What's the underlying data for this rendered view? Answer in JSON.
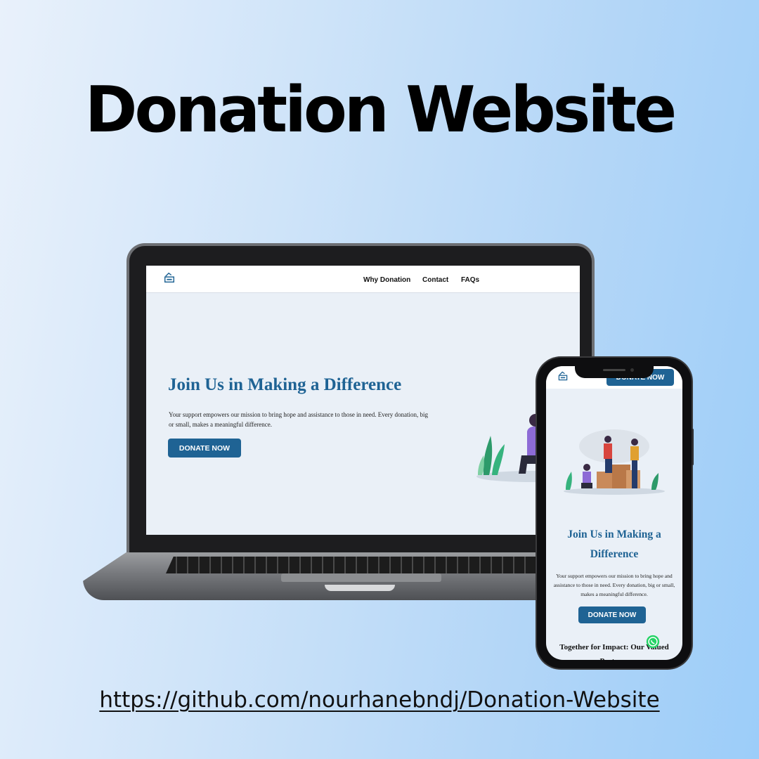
{
  "poster": {
    "title": "Donation Website",
    "link": "https://github.com/nourhanebndj/Donation-Website"
  },
  "desktop": {
    "nav": {
      "logo_icon": "donation-box-icon",
      "links": [
        "Why Donation",
        "Contact",
        "FAQs"
      ]
    },
    "hero": {
      "title": "Join Us in Making a Difference",
      "text": "Your support empowers our mission to bring hope and assistance to those in need. Every donation, big or small, makes a meaningful difference.",
      "button": "DONATE NOW"
    }
  },
  "mobile": {
    "header": {
      "logo_icon": "donation-box-icon",
      "button": "DONATE NOW"
    },
    "hero": {
      "title": "Join Us in Making a Difference",
      "text": "Your support empowers our mission to bring hope and assistance to those in need. Every donation, big or small, makes a meaningful difference.",
      "button": "DONATE NOW"
    },
    "section_title": "Together for Impact: Our Valued Partners",
    "chat_icon": "whatsapp-icon"
  },
  "colors": {
    "brand_blue": "#1f6394",
    "screen_bg": "#eaf0f7"
  }
}
